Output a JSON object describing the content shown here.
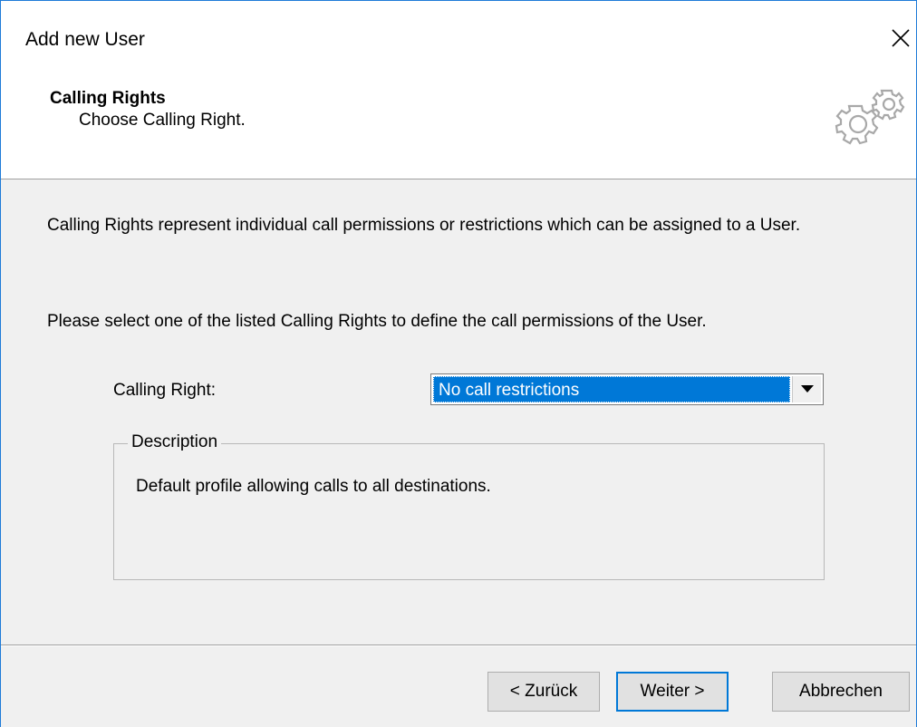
{
  "window": {
    "title": "Add new User",
    "close_glyph": "✕"
  },
  "header": {
    "title": "Calling Rights",
    "subtitle": "Choose Calling Right.",
    "icon": "gears-icon"
  },
  "content": {
    "paragraph1": "Calling Rights represent individual call permissions or restrictions which can be assigned to a User.",
    "paragraph2": "Please select one of the listed Calling Rights to define the call permissions of the User.",
    "calling_right_label": "Calling Right:",
    "calling_right_value": "No call restrictions",
    "description_legend": "Description",
    "description_text": "Default profile allowing calls to all destinations."
  },
  "buttons": {
    "back": "< Zurück",
    "next": "Weiter >",
    "cancel": "Abbrechen"
  },
  "colors": {
    "selection": "#0078d7",
    "window_border": "#1e7bd8",
    "dialog_bg": "#f0f0f0"
  }
}
